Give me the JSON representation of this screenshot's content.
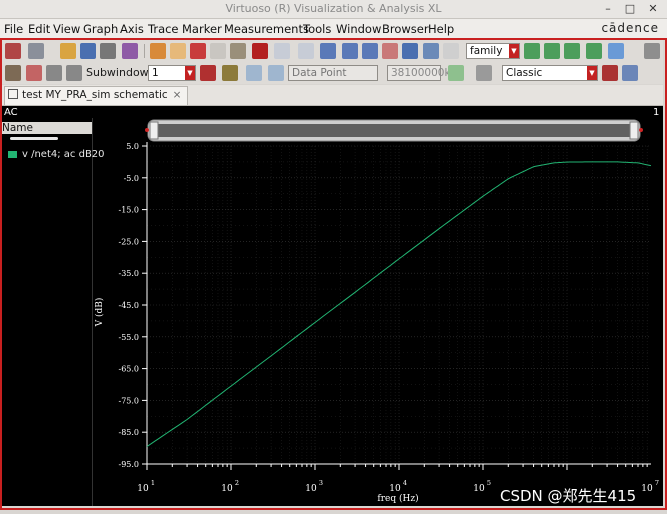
{
  "window": {
    "title": "Virtuoso (R) Visualization & Analysis XL",
    "controls": [
      "–",
      "□",
      "✕"
    ]
  },
  "menu": {
    "items": [
      "File",
      "Edit",
      "View",
      "Graph",
      "Axis",
      "Trace",
      "Marker",
      "Measurements",
      "Tools",
      "Window",
      "Browser",
      "Help"
    ],
    "brand": "cādence"
  },
  "toolbar1": {
    "family_value": "family"
  },
  "toolbar2": {
    "subwindows_label": "Subwindows:",
    "subwindows_value": "1",
    "datapoint_placeholder": "Data Point",
    "value_field": "38100000k",
    "style_value": "Classic"
  },
  "tab": {
    "label": "test MY_PRA_sim schematic",
    "close": "×"
  },
  "plot": {
    "analysis_label": "AC",
    "subwindow_number": "1",
    "sidebar_header": "Name",
    "trace_label": "v /net4; ac dB20",
    "trace_color": "#22b573"
  },
  "chart_data": {
    "type": "line",
    "title": "",
    "xlabel": "freq (Hz)",
    "ylabel": "V (dB)",
    "xscale": "log",
    "xlim": [
      10,
      10000000
    ],
    "ylim": [
      -95,
      5
    ],
    "yticks": [
      "5.0",
      "-5.0",
      "-15.0",
      "-25.0",
      "-35.0",
      "-45.0",
      "-55.0",
      "-65.0",
      "-75.0",
      "-85.0",
      "-95.0"
    ],
    "xticks": [
      {
        "base": "10",
        "exp": "1"
      },
      {
        "base": "10",
        "exp": "2"
      },
      {
        "base": "10",
        "exp": "3"
      },
      {
        "base": "10",
        "exp": "4"
      },
      {
        "base": "10",
        "exp": "5"
      },
      {
        "base": "10",
        "exp": "7"
      }
    ],
    "grid": true,
    "series": [
      {
        "name": "v /net4; ac dB20",
        "color": "#22b573",
        "x": [
          10,
          30,
          100,
          300,
          1000,
          3000,
          10000,
          30000,
          100000,
          200000,
          400000,
          700000,
          1000000,
          2000000,
          4000000,
          7000000,
          10000000
        ],
        "values": [
          -89.5,
          -81.0,
          -70.5,
          -61.0,
          -50.5,
          -41.0,
          -30.5,
          -21.0,
          -10.8,
          -5.3,
          -1.5,
          -0.3,
          -0.05,
          0.0,
          0.0,
          -0.3,
          -1.2
        ]
      }
    ]
  },
  "watermark": "CSDN @郑先生415"
}
